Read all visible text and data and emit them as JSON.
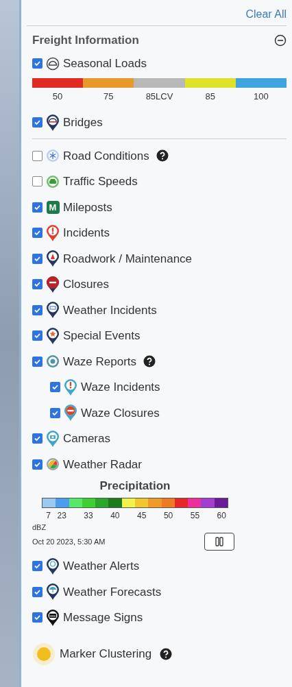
{
  "clear_all": "Clear All",
  "freight": {
    "title": "Freight Information",
    "expanded": true,
    "items": [
      {
        "label": "Seasonal Loads",
        "checked": true,
        "legend": [
          {
            "label": "50",
            "color": "#e02b24"
          },
          {
            "label": "75",
            "color": "#e8992b"
          },
          {
            "label": "85LCV",
            "color": "#b8b8b8"
          },
          {
            "label": "85",
            "color": "#dfe22a"
          },
          {
            "label": "100",
            "color": "#3fa3e0"
          }
        ]
      },
      {
        "label": "Bridges",
        "checked": true
      }
    ]
  },
  "layers": [
    {
      "label": "Road Conditions",
      "checked": false,
      "help": true
    },
    {
      "label": "Traffic Speeds",
      "checked": false
    },
    {
      "label": "Mileposts",
      "checked": true,
      "icon_text": "M"
    },
    {
      "label": "Incidents",
      "checked": true
    },
    {
      "label": "Roadwork / Maintenance",
      "checked": true
    },
    {
      "label": "Closures",
      "checked": true
    },
    {
      "label": "Weather Incidents",
      "checked": true
    },
    {
      "label": "Special Events",
      "checked": true
    },
    {
      "label": "Waze Reports",
      "checked": true,
      "help": true,
      "children": [
        {
          "label": "Waze Incidents",
          "checked": true
        },
        {
          "label": "Waze Closures",
          "checked": true
        }
      ]
    },
    {
      "label": "Cameras",
      "checked": true
    },
    {
      "label": "Weather Radar",
      "checked": true,
      "radar": {
        "title": "Precipitation",
        "segments": [
          {
            "color": "#9cc9f0"
          },
          {
            "color": "#4a9ef0"
          },
          {
            "color": "#57e86a"
          },
          {
            "color": "#3fcf33"
          },
          {
            "color": "#2aa72a"
          },
          {
            "color": "#1d7a1d"
          },
          {
            "color": "#f1f24a"
          },
          {
            "color": "#f2c72d"
          },
          {
            "color": "#ef9a2a"
          },
          {
            "color": "#ef7a24"
          },
          {
            "color": "#e8262a"
          },
          {
            "color": "#ee2e9a"
          },
          {
            "color": "#a33fd0"
          },
          {
            "color": "#6c1a9a"
          }
        ],
        "ticks": [
          "7",
          "23",
          "33",
          "40",
          "45",
          "50",
          "55",
          "60"
        ],
        "unit": "dBZ",
        "timestamp": "Oct 20 2023, 5:30 AM",
        "playing": true
      }
    },
    {
      "label": "Weather Alerts",
      "checked": true
    },
    {
      "label": "Weather Forecasts",
      "checked": true
    },
    {
      "label": "Message Signs",
      "checked": true
    }
  ],
  "clustering": {
    "label": "Marker Clustering",
    "help": true
  }
}
